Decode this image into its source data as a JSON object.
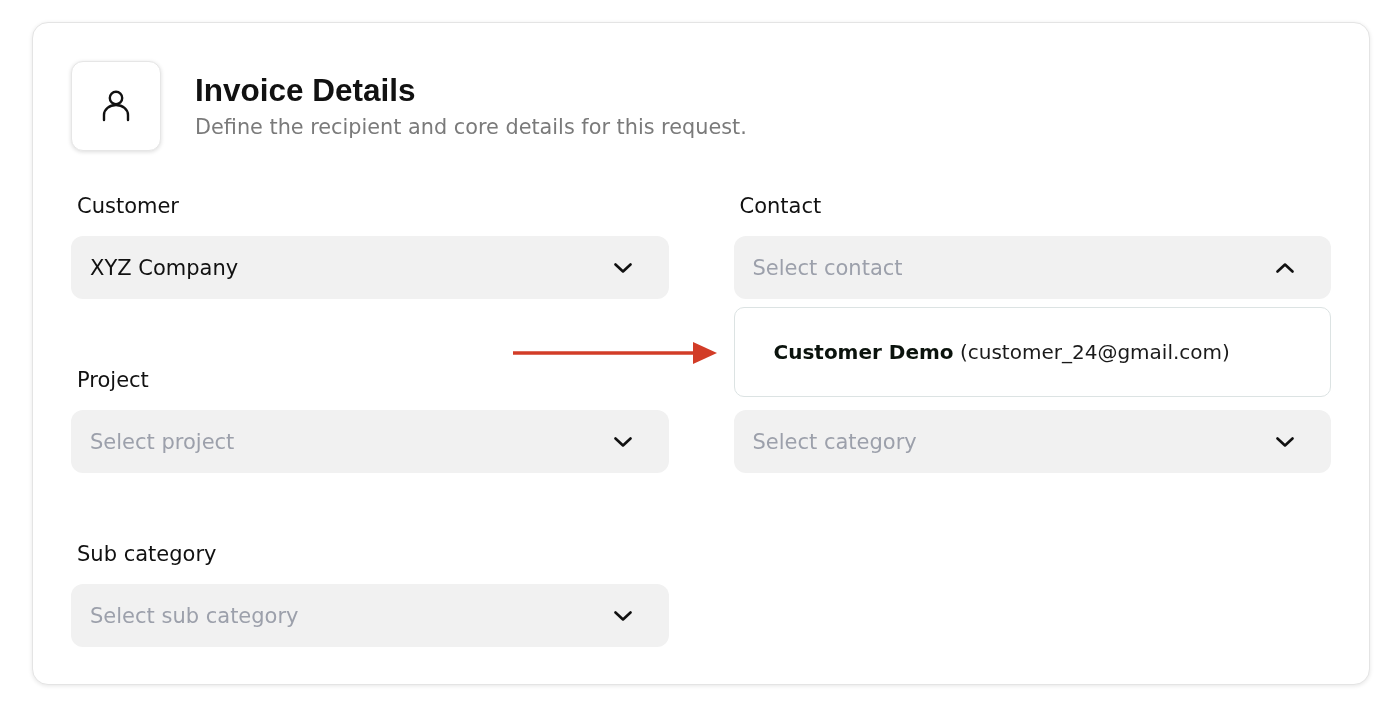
{
  "header": {
    "title": "Invoice Details",
    "subtitle": "Define the recipient and core details for this request."
  },
  "fields": [
    {
      "label": "Customer",
      "value": "XYZ Company",
      "expanded": false
    },
    {
      "label": "Contact",
      "placeholder": "Select contact",
      "expanded": true,
      "options": [
        {
          "text": "**Customer Demo** (customer_24@gmail.com)",
          "selected": false
        }
      ]
    },
    {
      "label": "Project",
      "placeholder": "Select project",
      "expanded": false
    },
    {
      "placeholder": "Select category",
      "expanded": false
    },
    {
      "label": "Sub category",
      "placeholder": "Select sub category",
      "expanded": false
    }
  ],
  "annotations": [
    {
      "kind": "arrow"
    }
  ]
}
